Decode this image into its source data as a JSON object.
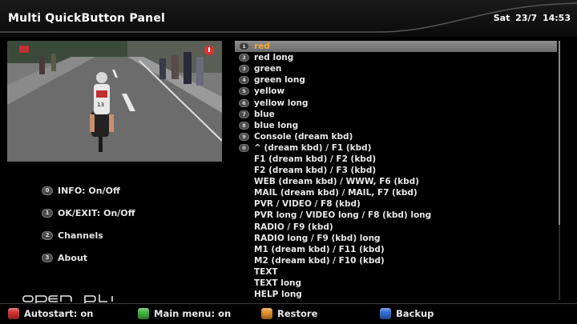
{
  "header": {
    "title": "Multi QuickButton Panel",
    "clock": "Sat 23/7  14:53"
  },
  "preview": {
    "channel_logo": "channel-logo-icon",
    "rider_number": "13"
  },
  "menu": {
    "items": [
      {
        "key": "0",
        "label": "INFO: On/Off"
      },
      {
        "key": "1",
        "label": "OK/EXIT: On/Off"
      },
      {
        "key": "2",
        "label": "Channels"
      },
      {
        "key": "3",
        "label": "About"
      }
    ]
  },
  "logo": {
    "text": "open pli"
  },
  "button_list": {
    "selected_index": 0,
    "items": [
      {
        "key": "1",
        "label": "red"
      },
      {
        "key": "2",
        "label": "red long"
      },
      {
        "key": "3",
        "label": "green"
      },
      {
        "key": "4",
        "label": "green long"
      },
      {
        "key": "5",
        "label": "yellow"
      },
      {
        "key": "6",
        "label": "yellow long"
      },
      {
        "key": "7",
        "label": "blue"
      },
      {
        "key": "8",
        "label": "blue long"
      },
      {
        "key": "9",
        "label": "Console (dream kbd)"
      },
      {
        "key": "0",
        "label": "^ (dream kbd) / F1 (kbd)"
      },
      {
        "key": "",
        "label": "F1 (dream kbd) / F2 (kbd)"
      },
      {
        "key": "",
        "label": "F2 (dream kbd) / F3 (kbd)"
      },
      {
        "key": "",
        "label": "WEB (dream kbd) / WWW, F6 (kbd)"
      },
      {
        "key": "",
        "label": "MAIL (dream kbd) / MAIL, F7 (kbd)"
      },
      {
        "key": "",
        "label": "PVR / VIDEO  / F8 (kbd)"
      },
      {
        "key": "",
        "label": "PVR long / VIDEO long / F8 (kbd) long"
      },
      {
        "key": "",
        "label": "RADIO  / F9 (kbd)"
      },
      {
        "key": "",
        "label": "RADIO long / F9 (kbd) long"
      },
      {
        "key": "",
        "label": "M1 (dream kbd) / F11 (kbd)"
      },
      {
        "key": "",
        "label": "M2 (dream kbd) / F10 (kbd)"
      },
      {
        "key": "",
        "label": "TEXT"
      },
      {
        "key": "",
        "label": "TEXT long"
      },
      {
        "key": "",
        "label": "HELP long"
      }
    ]
  },
  "footer": {
    "buttons": [
      {
        "color": "#d83030",
        "label": "Autostart: on"
      },
      {
        "color": "#3fb83f",
        "label": "Main menu: on"
      },
      {
        "color": "#e8922a",
        "label": "Restore"
      },
      {
        "color": "#2e6fd8",
        "label": "Backup"
      }
    ]
  },
  "colors": {
    "selected_text": "#f0a830",
    "selected_bar": "#7c7c7c"
  }
}
